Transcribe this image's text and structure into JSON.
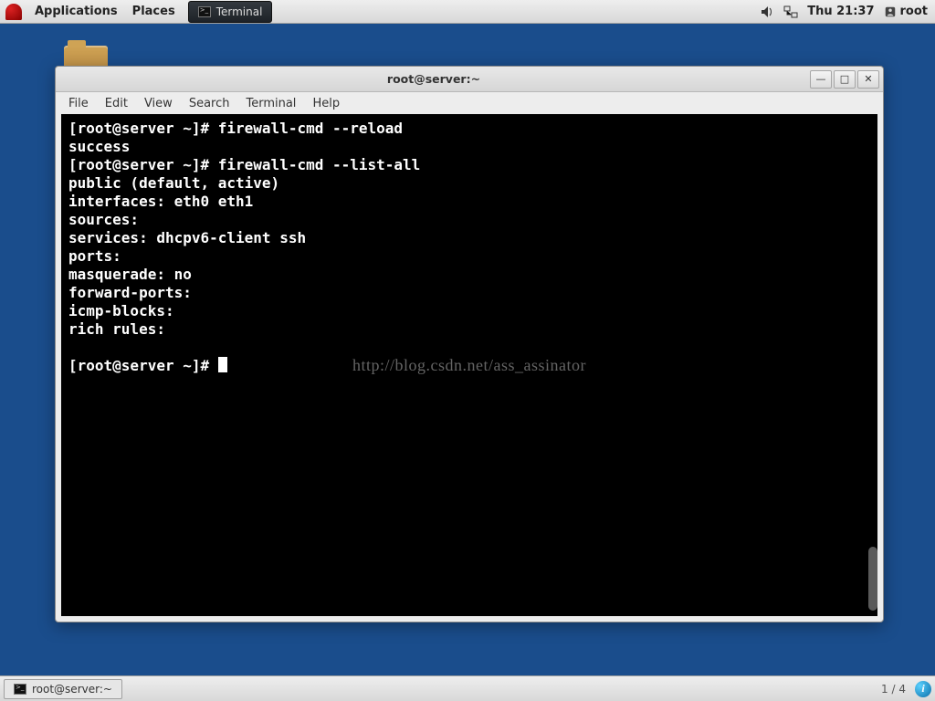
{
  "top_panel": {
    "applications": "Applications",
    "places": "Places",
    "task_label": "Terminal",
    "clock": "Thu 21:37",
    "user": "root"
  },
  "window": {
    "title": "root@server:~",
    "menu": {
      "file": "File",
      "edit": "Edit",
      "view": "View",
      "search": "Search",
      "terminal": "Terminal",
      "help": "Help"
    }
  },
  "terminal": {
    "lines": [
      "[root@server ~]# firewall-cmd --reload",
      "success",
      "[root@server ~]# firewall-cmd --list-all",
      "public (default, active)",
      "  interfaces: eth0 eth1",
      "  sources: ",
      "  services: dhcpv6-client ssh",
      "  ports: ",
      "  masquerade: no",
      "  forward-ports: ",
      "  icmp-blocks: ",
      "  rich rules: ",
      "",
      "[root@server ~]# "
    ],
    "watermark": "http://blog.csdn.net/ass_assinator"
  },
  "bottom_panel": {
    "task_label": "root@server:~",
    "workspace": "1 / 4"
  }
}
